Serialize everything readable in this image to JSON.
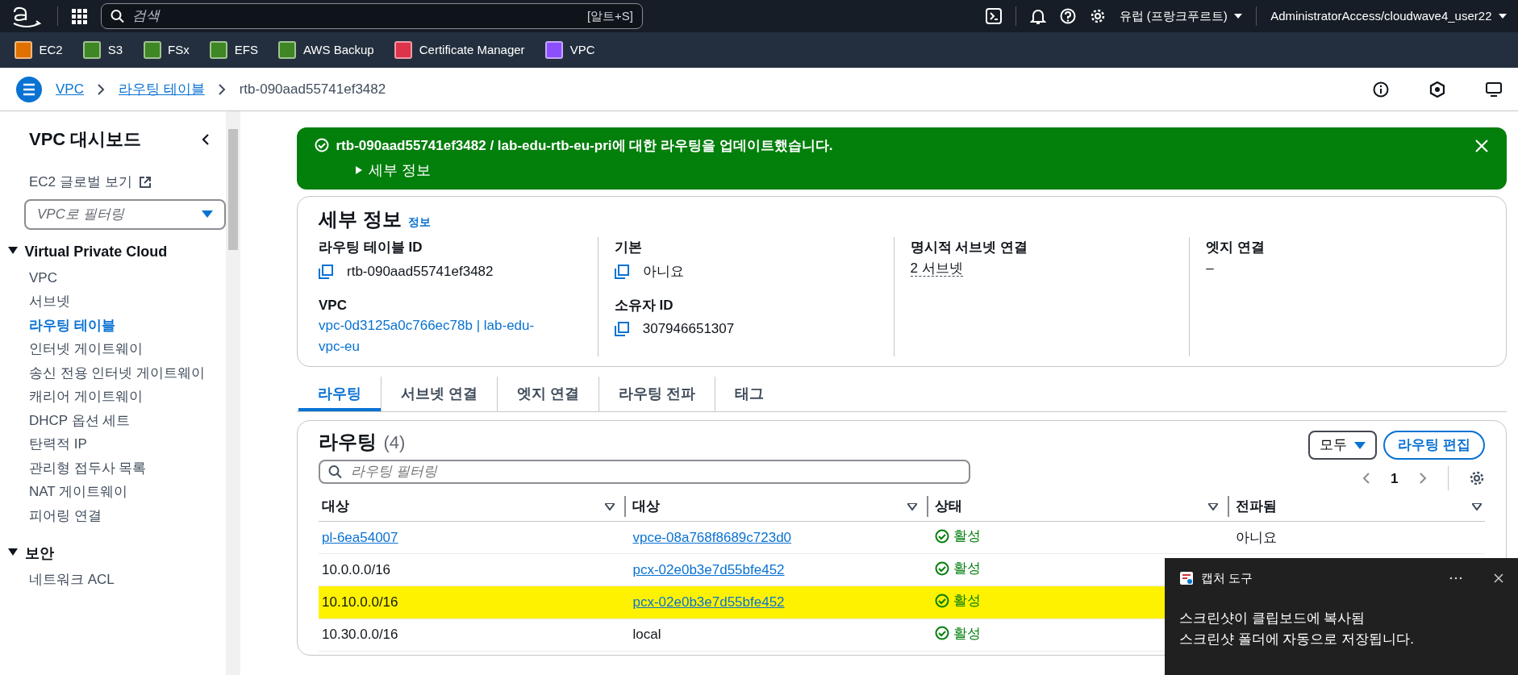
{
  "top_nav": {
    "search": {
      "placeholder": "검색",
      "shortcut": "[알트+S]"
    },
    "region": "유럽 (프랑크푸르트)",
    "account": "AdministratorAccess/cloudwave4_user22"
  },
  "favorites": [
    {
      "label": "EC2",
      "color": "#e07000"
    },
    {
      "label": "S3",
      "color": "#3f8624"
    },
    {
      "label": "FSx",
      "color": "#3f8624"
    },
    {
      "label": "EFS",
      "color": "#3f8624"
    },
    {
      "label": "AWS Backup",
      "color": "#3f8624"
    },
    {
      "label": "Certificate Manager",
      "color": "#dd344c"
    },
    {
      "label": "VPC",
      "color": "#8c4fff"
    }
  ],
  "breadcrumb": [
    {
      "label": "VPC",
      "link": true
    },
    {
      "label": "라우팅 테이블",
      "link": true
    },
    {
      "label": "rtb-090aad55741ef3482",
      "link": false
    }
  ],
  "sidebar": {
    "title": "VPC 대시보드",
    "external_link": "EC2 글로벌 보기",
    "filter": {
      "placeholder": "VPC로 필터링"
    },
    "sections": [
      {
        "title": "Virtual Private Cloud",
        "expanded": true,
        "items": [
          {
            "label": "VPC",
            "selected": false
          },
          {
            "label": "서브넷",
            "selected": false
          },
          {
            "label": "라우팅 테이블",
            "selected": true
          },
          {
            "label": "인터넷 게이트웨이",
            "selected": false
          },
          {
            "label": "송신 전용 인터넷 게이트웨이",
            "selected": false
          },
          {
            "label": "캐리어 게이트웨이",
            "selected": false
          },
          {
            "label": "DHCP 옵션 세트",
            "selected": false
          },
          {
            "label": "탄력적 IP",
            "selected": false
          },
          {
            "label": "관리형 접두사 목록",
            "selected": false
          },
          {
            "label": "NAT 게이트웨이",
            "selected": false
          },
          {
            "label": "피어링 연결",
            "selected": false
          }
        ]
      },
      {
        "title": "보안",
        "expanded": true,
        "items": [
          {
            "label": "네트워크 ACL",
            "selected": false
          }
        ]
      }
    ]
  },
  "flash": {
    "message": "rtb-090aad55741ef3482 / lab-edu-rtb-eu-pri에 대한 라우팅을 업데이트했습니다.",
    "details_toggle": "세부 정보"
  },
  "details": {
    "title": "세부 정보",
    "info": "정보",
    "columns": [
      [
        {
          "label": "라우팅 테이블 ID",
          "value": "rtb-090aad55741ef3482",
          "kind": "copy"
        },
        {
          "label": "VPC",
          "value": "vpc-0d3125a0c766ec78b | lab-edu-vpc-eu",
          "kind": "link"
        }
      ],
      [
        {
          "label": "기본",
          "value": "아니요",
          "kind": "copy"
        },
        {
          "label": "소유자 ID",
          "value": "307946651307",
          "kind": "copy"
        }
      ],
      [
        {
          "label": "명시적 서브넷 연결",
          "value": "2 서브넷",
          "kind": "popover"
        }
      ],
      [
        {
          "label": "엣지 연결",
          "value": "–",
          "kind": "text"
        }
      ]
    ]
  },
  "tabs": [
    {
      "label": "라우팅",
      "selected": true
    },
    {
      "label": "서브넷 연결",
      "selected": false
    },
    {
      "label": "엣지 연결",
      "selected": false
    },
    {
      "label": "라우팅 전파",
      "selected": false
    },
    {
      "label": "태그",
      "selected": false
    }
  ],
  "routes": {
    "title": "라우팅",
    "count": "(4)",
    "filter_button": "모두",
    "edit_button": "라우팅 편집",
    "filter": {
      "placeholder": "라우팅 필터링"
    },
    "page": "1",
    "columns": [
      "대상",
      "대상",
      "상태",
      "전파됨"
    ],
    "rows": [
      {
        "destination": "pl-6ea54007",
        "destination_link": true,
        "target": "vpce-08a768f8689c723d0",
        "target_link": true,
        "status": "활성",
        "propagated": "아니요",
        "marked": false
      },
      {
        "destination": "10.0.0.0/16",
        "destination_link": false,
        "target": "pcx-02e0b3e7d55bfe452",
        "target_link": true,
        "status": "활성",
        "marked": false
      },
      {
        "destination": "10.10.0.0/16",
        "destination_link": false,
        "target": "pcx-02e0b3e7d55bfe452",
        "target_link": true,
        "status": "활성",
        "marked": true
      },
      {
        "destination": "10.30.0.0/16",
        "destination_link": false,
        "target": "local",
        "target_link": false,
        "status": "활성",
        "marked": false
      }
    ]
  },
  "toast": {
    "title": "캡처 도구",
    "lines": [
      "스크린샷이 클립보드에 복사됨",
      "스크린샷 폴더에 자동으로 저장됩니다."
    ]
  }
}
